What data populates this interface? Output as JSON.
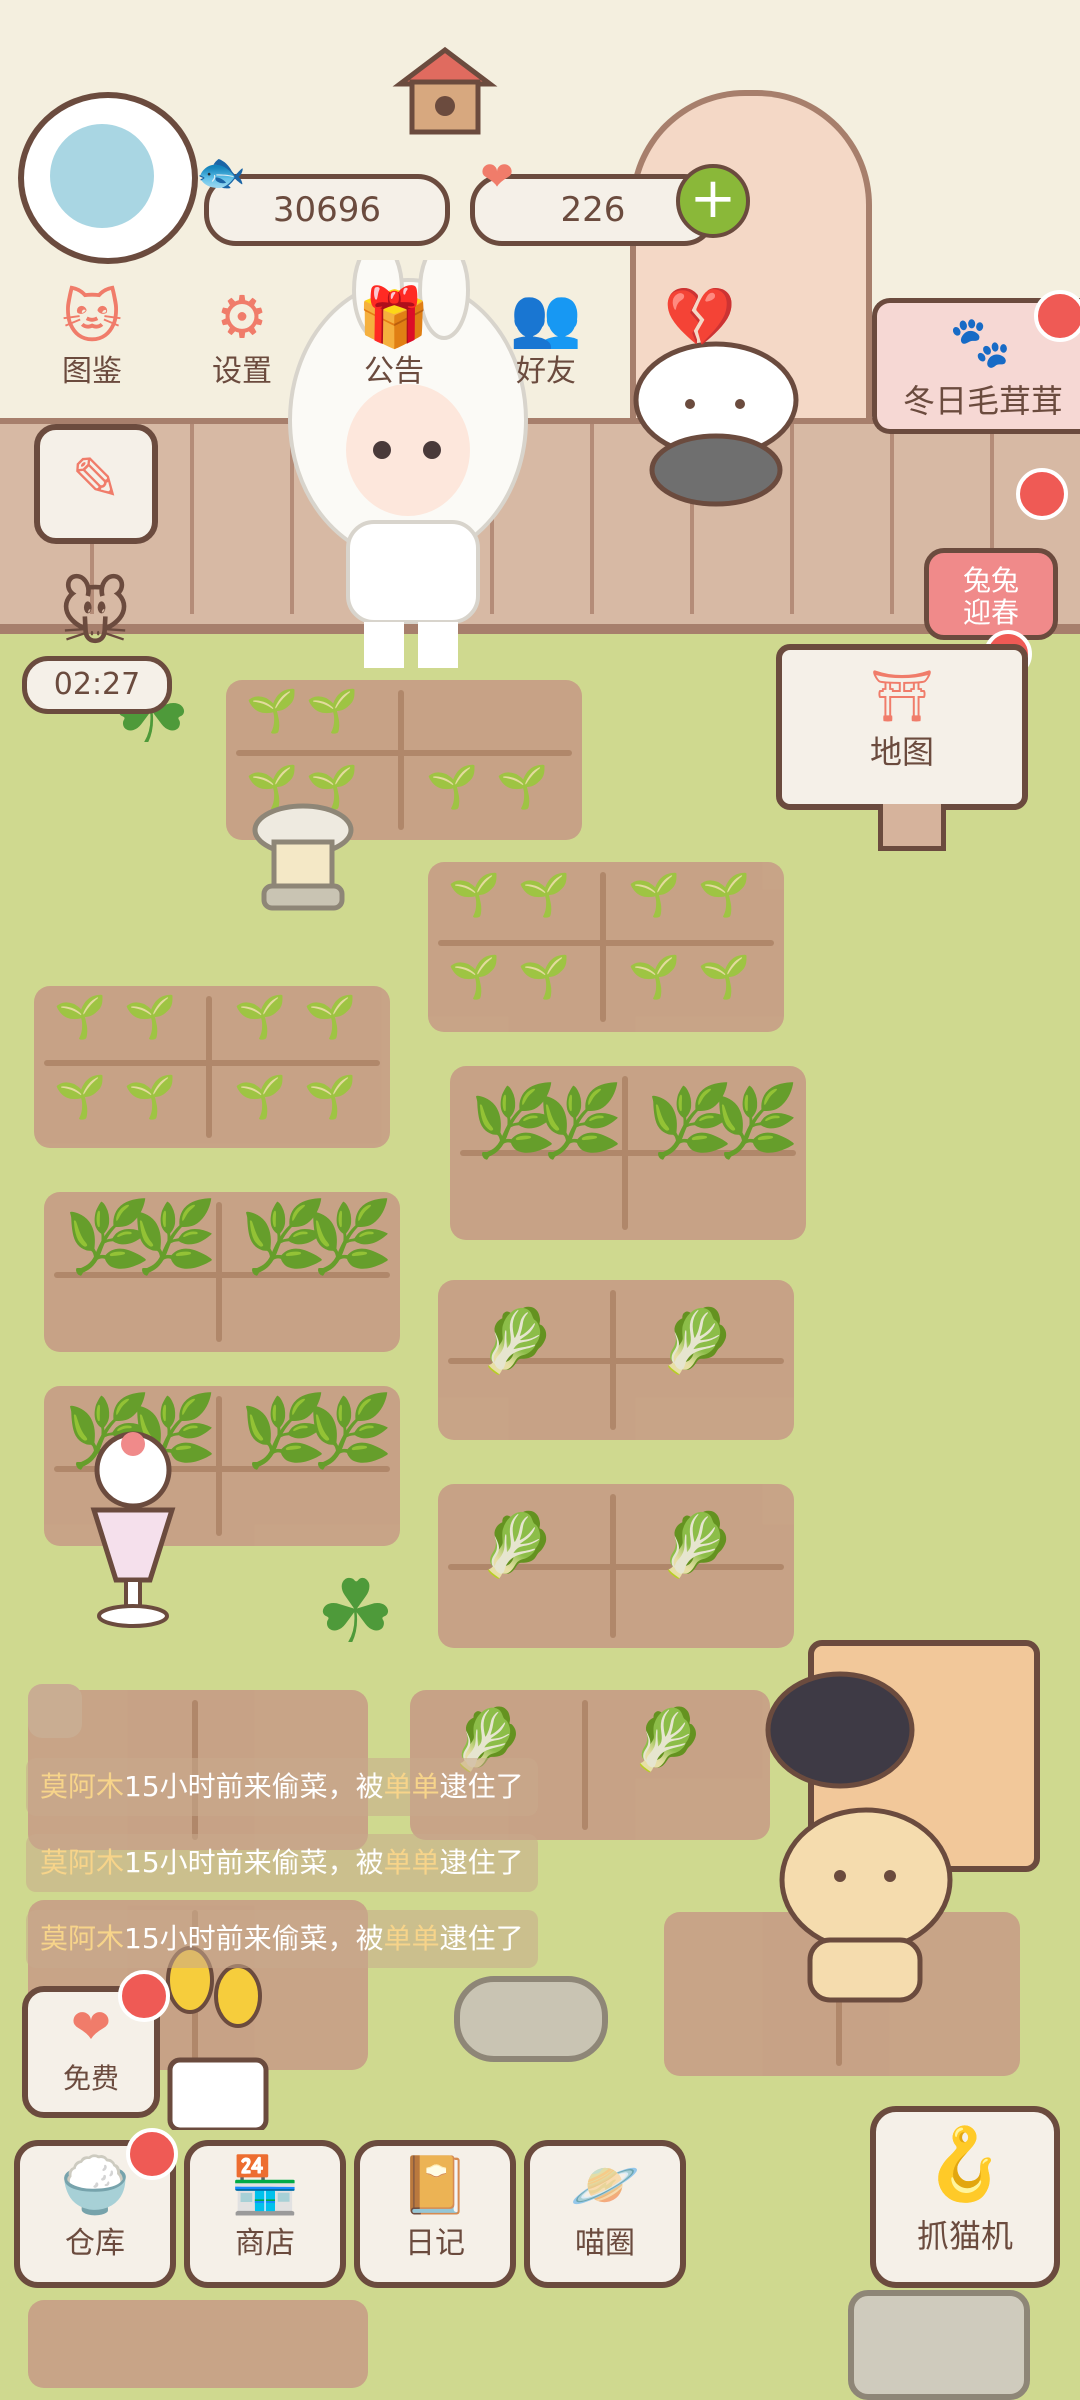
{
  "hud": {
    "fish_count": "30696",
    "heart_count": "226"
  },
  "menu": [
    {
      "label": "图鉴",
      "icon": "cat-head-icon"
    },
    {
      "label": "设置",
      "icon": "gear-icon"
    },
    {
      "label": "公告",
      "icon": "gift-icon"
    },
    {
      "label": "好友",
      "icon": "friends-icon"
    }
  ],
  "event_banner": {
    "label": "冬日毛茸茸"
  },
  "bunny_event": {
    "label_line1": "兔兔",
    "label_line2": "迎春"
  },
  "timer": {
    "value": "02:27"
  },
  "map_sign": {
    "label": "地图"
  },
  "logs": [
    {
      "name": "莫阿木",
      "text_a": "15小时前来偷菜，被",
      "catcher": "单单",
      "text_b": "逮住了"
    },
    {
      "name": "莫阿木",
      "text_a": "15小时前来偷菜，被",
      "catcher": "单单",
      "text_b": "逮住了"
    },
    {
      "name": "莫阿木",
      "text_a": "15小时前来偷菜，被",
      "catcher": "单单",
      "text_b": "逮住了"
    }
  ],
  "free_button": {
    "label": "免费"
  },
  "bottom_bar": [
    {
      "label": "仓库"
    },
    {
      "label": "商店"
    },
    {
      "label": "日记"
    },
    {
      "label": "喵圈"
    }
  ],
  "claw_machine": {
    "label": "抓猫机"
  },
  "colors": {
    "accent": "#f07c6a",
    "outline": "#6b4b3e",
    "badge": "#ef5a55",
    "grass": "#cfd98f",
    "soil": "#c79d86"
  }
}
